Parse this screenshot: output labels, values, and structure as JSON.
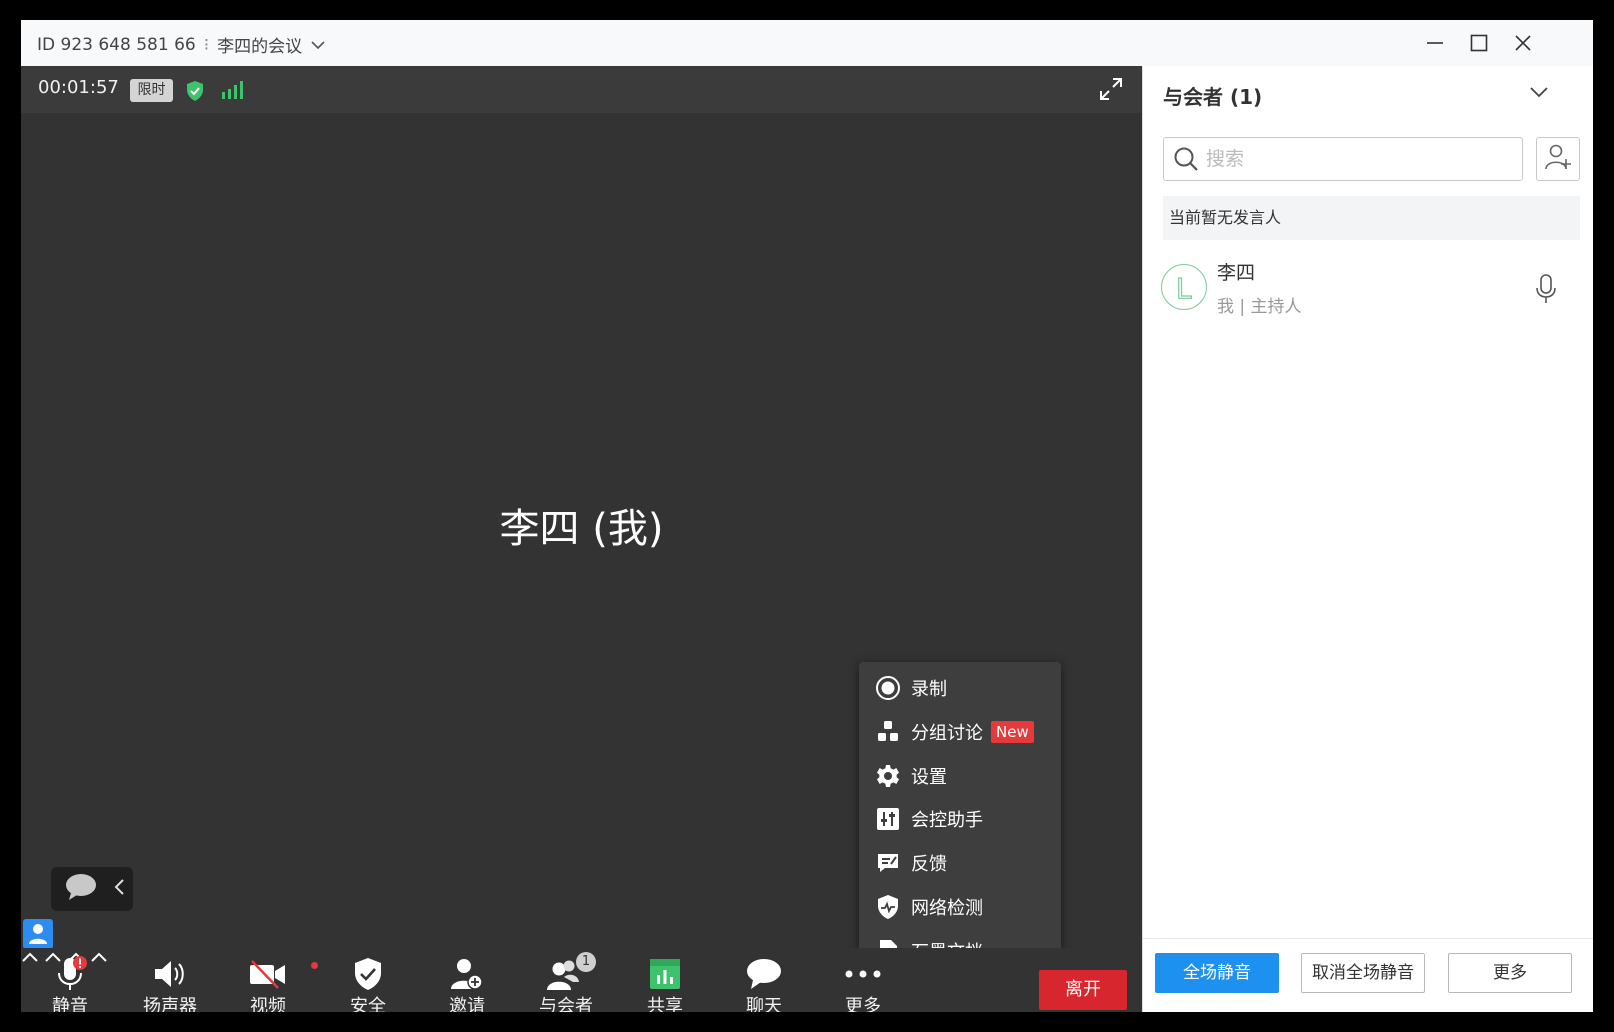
{
  "titlebar": {
    "meeting_id": "ID 923 648 581 66",
    "separator": "⁝",
    "meeting_name": "李四的会议"
  },
  "video": {
    "timer": "00:01:57",
    "limit_badge": "限时",
    "center_name": "李四 (我)"
  },
  "more_menu": {
    "items": [
      {
        "label": "录制",
        "icon": "record-icon"
      },
      {
        "label": "分组讨论",
        "icon": "breakout-icon",
        "badge": "New"
      },
      {
        "label": "设置",
        "icon": "gear-icon"
      },
      {
        "label": "会控助手",
        "icon": "control-assistant-icon"
      },
      {
        "label": "反馈",
        "icon": "feedback-icon"
      },
      {
        "label": "网络检测",
        "icon": "network-check-icon"
      },
      {
        "label": "石墨文档",
        "icon": "document-icon"
      }
    ]
  },
  "toolbar": {
    "mute": "静音",
    "speaker": "扬声器",
    "video": "视频",
    "security": "安全",
    "invite": "邀请",
    "participants": "与会者",
    "participants_count": "1",
    "share": "共享",
    "chat": "聊天",
    "more": "更多",
    "leave": "离开"
  },
  "panel": {
    "title": "与会者 (1)",
    "search_placeholder": "搜索",
    "no_speaker": "当前暂无发言人",
    "participant": {
      "name": "李四",
      "role": "我 | 主持人",
      "avatar_letter": "L"
    },
    "footer": {
      "mute_all": "全场静音",
      "unmute_all": "取消全场静音",
      "more": "更多"
    }
  },
  "colors": {
    "accent_blue": "#1e90f0",
    "leave_red": "#d7262d",
    "shield_green": "#3ec26b",
    "new_badge_red": "#e6393b"
  }
}
